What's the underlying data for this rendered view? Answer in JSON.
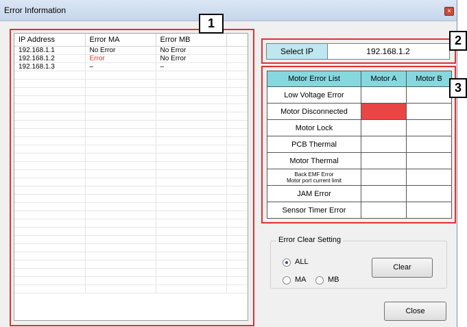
{
  "window": {
    "title": "Error Information",
    "close_glyph": "×"
  },
  "callouts": [
    "1",
    "2",
    "3"
  ],
  "error_list": {
    "columns": [
      "IP Address",
      "Error MA",
      "Error MB"
    ],
    "rows": [
      [
        "192.168.1.1",
        "No Error",
        "No Error"
      ],
      [
        "192.168.1.2",
        "Error",
        "No Error"
      ],
      [
        "192.168.1.3",
        "–",
        "–"
      ]
    ]
  },
  "select_ip": {
    "label": "Select IP",
    "value": "192.168.1.2"
  },
  "motor_errors": {
    "headers": [
      "Motor Error List",
      "Motor A",
      "Motor B"
    ],
    "rows": [
      "Low Voltage Error",
      "Motor Disconnected",
      "Motor Lock",
      "PCB Thermal",
      "Motor Thermal",
      "Back EMF Error",
      "JAM Error",
      "Sensor Timer Error"
    ],
    "back_emf_line2": "Motor port current limit",
    "error_color": "#e94545",
    "header_color": "#86d8df"
  },
  "error_clear": {
    "title": "Error Clear Setting",
    "options": [
      "ALL",
      "MA",
      "MB"
    ],
    "selected": "ALL",
    "clear_label": "Clear"
  },
  "close_label": "Close"
}
